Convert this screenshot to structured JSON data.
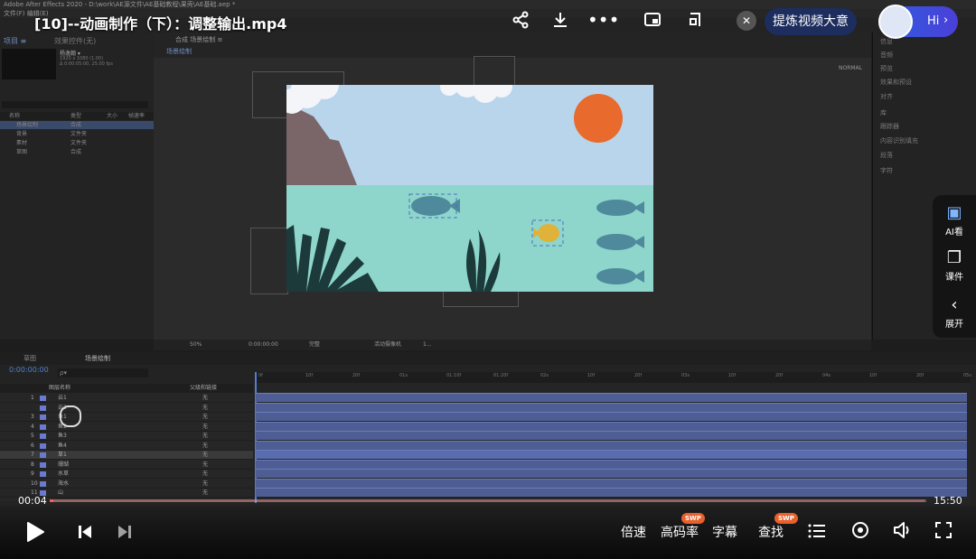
{
  "ae": {
    "window_title": "Adobe After Effects 2020 - D:\\work\\AE源文件\\AE基础教程\\果壳\\AE基础.aep *",
    "menu_label": "文件(F)   编辑(E)",
    "panel_left_tab": "项目 ≡",
    "panel_left_tab2": "效果控件(无)",
    "project_item_name": "杨逸翰 ▾",
    "project_item_info1": "1920 x 1080 (1.00)",
    "project_item_info2": "Δ 0:00:05:00, 25.00 fps",
    "project_columns": [
      "名称",
      "类型",
      "大小",
      "帧速率"
    ],
    "project_items": [
      {
        "name": "场景绘制",
        "type": "合成"
      },
      {
        "name": "背景",
        "type": "文件夹"
      },
      {
        "name": "素材",
        "type": "文件夹"
      },
      {
        "name": "草图",
        "type": "合成"
      }
    ],
    "viewer_tab": "合成 场景绘制 ≡",
    "viewer_subtab": "场景绘制",
    "viewer_normal": "NORMAL",
    "viewer_zoom": "50%",
    "viewer_time": "0:00:00:00",
    "viewer_quality": "完整",
    "viewer_camera": "活动摄像机",
    "viewer_views": "1...",
    "right_panel_items": [
      "信息",
      "音频",
      "预览",
      "效果和预设",
      "对齐",
      "库",
      "跟踪器",
      "内容识别填充",
      "段落",
      "字符"
    ],
    "timeline_tabs": [
      "草图",
      "场景绘制"
    ],
    "timecode": "0:00:00:00",
    "search_placeholder": "ρ▾",
    "layer_columns": [
      "图层名称",
      "父级和链接"
    ],
    "layers": [
      {
        "num": "1",
        "name": "云1",
        "parent": "无"
      },
      {
        "name": "云2",
        "parent": "无"
      },
      {
        "num": "3",
        "name": "鱼1",
        "parent": "无"
      },
      {
        "num": "4",
        "name": "鱼2",
        "parent": "无"
      },
      {
        "num": "5",
        "name": "鱼3",
        "parent": "无"
      },
      {
        "num": "6",
        "name": "鱼4",
        "parent": "无"
      },
      {
        "num": "7",
        "name": "草1",
        "parent": "无"
      },
      {
        "num": "8",
        "name": "珊瑚",
        "parent": "无"
      },
      {
        "num": "9",
        "name": "水草",
        "parent": "无"
      },
      {
        "num": "10",
        "name": "海水",
        "parent": "无"
      },
      {
        "num": "11",
        "name": "山",
        "parent": "无"
      }
    ],
    "ruler_ticks": [
      "0f",
      "10f",
      "20f",
      "01s",
      "01:10f",
      "01:20f",
      "02s",
      "10f",
      "20f",
      "03s",
      "10f",
      "20f",
      "04s",
      "10f",
      "20f",
      "05s"
    ]
  },
  "player": {
    "title": "[10]--动画制作（下）：调整输出.mp4",
    "summary_button": "提炼视频大意",
    "hi_button": "Hi",
    "time_current": "00:04",
    "time_total": "15:50",
    "progress_fraction": 0.0042,
    "controls": {
      "speed": "倍速",
      "quality": "高码率",
      "subtitle": "字幕",
      "search": "查找",
      "swp_badge": "SWP"
    },
    "side_panel": [
      {
        "label": "AI看",
        "icon": "ai-view-icon"
      },
      {
        "label": "课件",
        "icon": "courseware-icon"
      },
      {
        "label": "展开",
        "icon": "chevron-left-icon"
      }
    ],
    "colors": {
      "accent_red": "#ff5a5a",
      "summary_bg": "#1c2d5e",
      "hi_gradient": "#2f5fe0",
      "swp_badge": "#e8612c"
    }
  },
  "scene": {
    "colors": {
      "sky": "#b9d5ec",
      "water": "#8ed6cb",
      "sun": "#e86a2c",
      "fish": "#4e8a9c",
      "yellow_fish": "#e0b23a",
      "mountain": "#7a6668",
      "plant": "#1d3a3a"
    }
  }
}
